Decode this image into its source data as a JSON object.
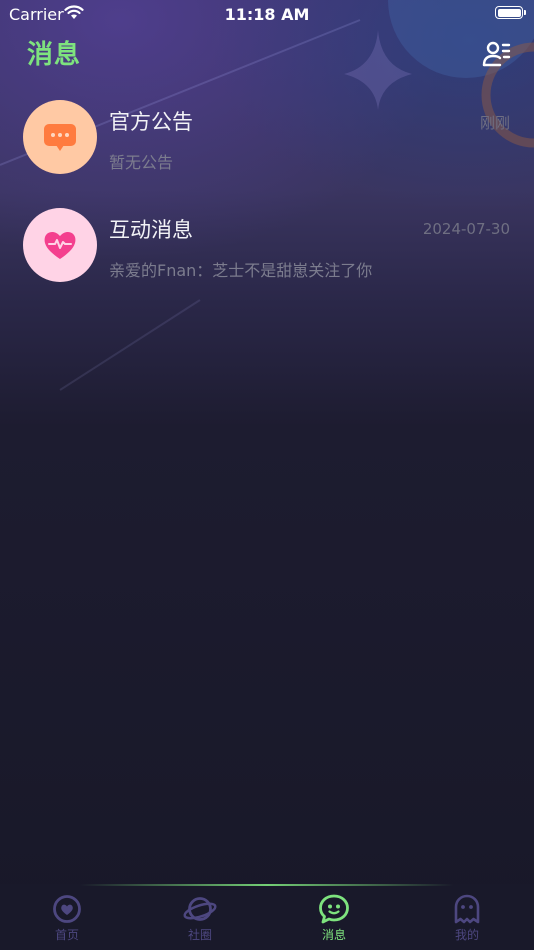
{
  "status_bar": {
    "carrier": "Carrier",
    "time": "11:18 AM"
  },
  "header": {
    "title": "消息",
    "contacts_icon": "contacts-settings-icon"
  },
  "messages": [
    {
      "title": "官方公告",
      "subtitle": "暂无公告",
      "time": "刚刚",
      "icon": "chat-bubble-icon",
      "icon_bg": "#ffc9a4"
    },
    {
      "title": "互动消息",
      "subtitle": "亲爱的Fnan：芝士不是甜崽关注了你",
      "time": "2024-07-30",
      "icon": "heart-pulse-icon",
      "icon_bg": "#ffd3e6"
    }
  ],
  "tabbar": {
    "items": [
      {
        "label": "首页",
        "icon": "home-heart-icon",
        "active": false
      },
      {
        "label": "社圈",
        "icon": "planet-icon",
        "active": false
      },
      {
        "label": "消息",
        "icon": "message-face-icon",
        "active": true
      },
      {
        "label": "我的",
        "icon": "ghost-profile-icon",
        "active": false
      }
    ]
  },
  "colors": {
    "accent": "#7ee37e",
    "inactive_tab": "#4d4780",
    "background": "#1a1a2a"
  }
}
